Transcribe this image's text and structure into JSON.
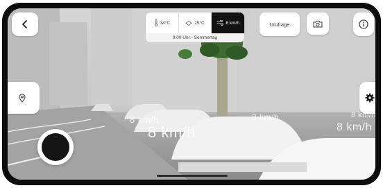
{
  "stats": {
    "temperature": "34°C",
    "surface_temperature": "25°C",
    "wind_speed": "8 km/h",
    "time_label": "9:00 Uhr - Sommertag"
  },
  "toolbar": {
    "survey_label": "Umfrage"
  },
  "scene": {
    "wind_labels": [
      "8 km/h",
      "8 km/h",
      "8 km/h",
      "8 km/h",
      "8 km/h"
    ]
  },
  "icons": {
    "back": "chevron-left-icon",
    "info": "info-icon",
    "camera": "camera-icon",
    "location": "map-pin-icon",
    "settings": "gear-icon",
    "thermometer": "thermometer-icon",
    "surface": "diamond-icon",
    "wind": "wind-icon"
  },
  "colors": {
    "active_tab": "#111111",
    "button_background": "#ffffff",
    "record_button": "#141414"
  }
}
